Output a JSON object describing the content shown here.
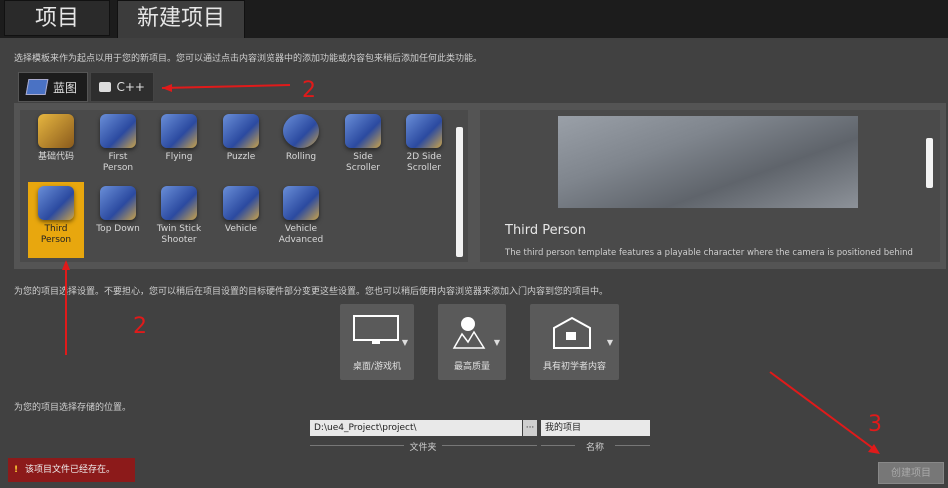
{
  "tabs": {
    "projects": "项目",
    "new_project": "新建项目"
  },
  "hint_top": "选择模板来作为起点以用于您的新项目。您可以通过点击内容浏览器中的添加功能或内容包来稍后添加任何此类功能。",
  "sub_tabs": {
    "blueprint": "蓝图",
    "cpp": "C++"
  },
  "templates": [
    {
      "l1": "基础代码",
      "l2": ""
    },
    {
      "l1": "First",
      "l2": "Person"
    },
    {
      "l1": "Flying",
      "l2": ""
    },
    {
      "l1": "Puzzle",
      "l2": ""
    },
    {
      "l1": "Rolling",
      "l2": ""
    },
    {
      "l1": "Side",
      "l2": "Scroller"
    },
    {
      "l1": "2D Side",
      "l2": "Scroller"
    },
    {
      "l1": "Third",
      "l2": "Person"
    },
    {
      "l1": "Top Down",
      "l2": ""
    },
    {
      "l1": "Twin Stick",
      "l2": "Shooter"
    },
    {
      "l1": "Vehicle",
      "l2": ""
    },
    {
      "l1": "Vehicle",
      "l2": "Advanced"
    }
  ],
  "preview": {
    "title": "Third Person",
    "desc": "The third person template features a playable character where the camera is positioned behind"
  },
  "hint_settings": "为您的项目选择设置。不要担心，您可以稍后在项目设置的目标硬件部分变更这些设置。您也可以稍后使用内容浏览器来添加入门内容到您的项目中。",
  "settings": {
    "platform": "桌面/游戏机",
    "quality": "最高质量",
    "starter": "具有初学者内容"
  },
  "hint_location": "为您的项目选择存储的位置。",
  "location": {
    "folder_value": "D:\\ue4_Project\\project\\",
    "browse": "···",
    "name_value": "我的项目",
    "folder_caption": "文件夹",
    "name_caption": "名称"
  },
  "error": "该项目文件已经存在。",
  "create_button": "创建项目",
  "annotations": {
    "a1": "2",
    "a2": "2",
    "a3": "3"
  }
}
